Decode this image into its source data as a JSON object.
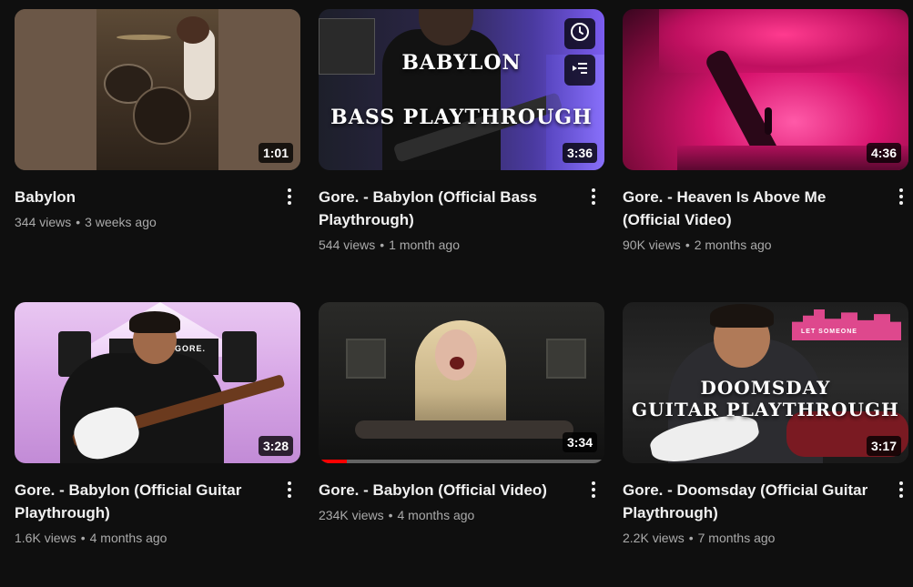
{
  "videos": [
    {
      "title": "Babylon",
      "views": "344 views",
      "age": "3 weeks ago",
      "duration": "1:01"
    },
    {
      "title": "Gore. - Babylon (Official Bass Playthrough)",
      "views": "544 views",
      "age": "1 month ago",
      "duration": "3:36",
      "overlay_line1": "BABYLON",
      "overlay_line2": "BASS PLAYTHROUGH",
      "hover_icons": [
        "clock-icon",
        "add-to-queue-icon"
      ]
    },
    {
      "title": "Gore. - Heaven Is Above Me (Official Video)",
      "views": "90K views",
      "age": "2 months ago",
      "duration": "4:36"
    },
    {
      "title": "Gore. - Babylon (Official Guitar Playthrough)",
      "views": "1.6K views",
      "age": "4 months ago",
      "duration": "3:28",
      "sign_text": "GORE."
    },
    {
      "title": "Gore. - Babylon (Official Video)",
      "views": "234K views",
      "age": "4 months ago",
      "duration": "3:34",
      "watched_progress": 0.1
    },
    {
      "title": "Gore. - Doomsday (Official Guitar Playthrough)",
      "views": "2.2K views",
      "age": "7 months ago",
      "duration": "3:17",
      "overlay_line1": "DOOMSDAY",
      "overlay_line2": "GUITAR PLAYTHROUGH",
      "sign_text": "LET SOMEONE"
    }
  ],
  "separator": "•",
  "colors": {
    "background": "#0f0f0f",
    "title": "#f1f1f1",
    "meta": "#aaaaaa",
    "progress": "#ff0000"
  }
}
